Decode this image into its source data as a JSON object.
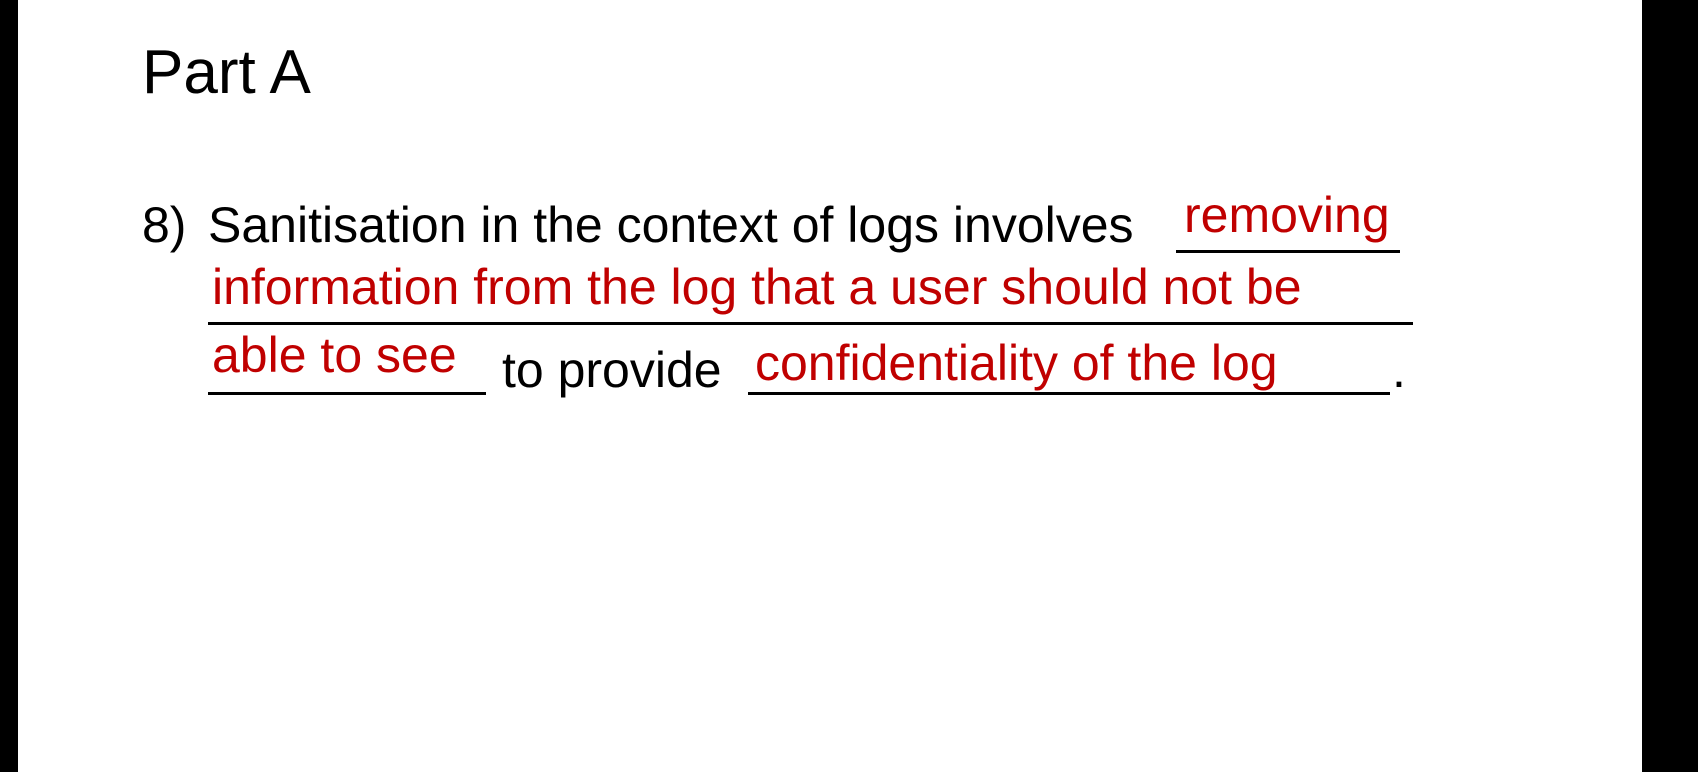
{
  "slide": {
    "title": "Part A",
    "question": {
      "number": "8)",
      "text_before": "Sanitisation in the context of logs involves",
      "text_middle": "to provide",
      "text_end": "."
    },
    "answers": {
      "blank1_line1": "removing",
      "blank1_line2": "information from the log that a user should not be",
      "blank1_line3": "able to see",
      "blank2": "confidentiality of the log"
    },
    "colors": {
      "answer": "#c00000",
      "text": "#000000",
      "background": "#ffffff",
      "frame": "#000000"
    }
  }
}
